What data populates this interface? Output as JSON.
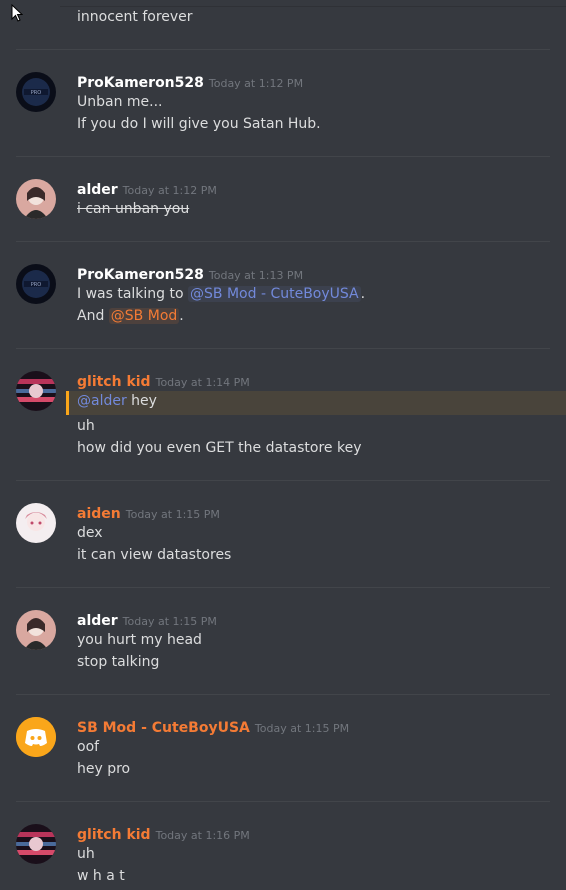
{
  "top_text": "innocent forever",
  "messages": [
    {
      "author": "ProKameron528",
      "timestamp": "Today at 1:12 PM",
      "lines": [
        "Unban me...",
        "If you do I will give you Satan Hub."
      ]
    },
    {
      "author": "alder",
      "timestamp": "Today at 1:12 PM",
      "lines": [
        "i can unban you"
      ]
    },
    {
      "author": "ProKameron528",
      "timestamp": "Today at 1:13 PM",
      "line1_prefix": "I was talking to ",
      "line1_mention": "@SB Mod - CuteBoyUSA",
      "line1_suffix": ".",
      "line2_prefix": "And ",
      "line2_mention": "@SB Mod",
      "line2_suffix": "."
    },
    {
      "author": "glitch kid",
      "timestamp": "Today at 1:14 PM",
      "line1_mention": "@alder",
      "line1_text": " hey",
      "lines": [
        "uh",
        "how did you even GET the datastore key"
      ]
    },
    {
      "author": "aiden",
      "timestamp": "Today at 1:15 PM",
      "lines": [
        "dex",
        "it can view datastores"
      ]
    },
    {
      "author": "alder",
      "timestamp": "Today at 1:15 PM",
      "lines": [
        "you hurt my head",
        "stop talking"
      ]
    },
    {
      "author": "SB Mod - CuteBoyUSA",
      "timestamp": "Today at 1:15 PM",
      "lines": [
        "oof",
        "hey pro"
      ]
    },
    {
      "author": "glitch kid",
      "timestamp": "Today at 1:16 PM",
      "lines": [
        "uh",
        "w h a t"
      ]
    }
  ],
  "colors": {
    "background": "#36393f",
    "mention": "#7289da",
    "orange_role": "#f47b35",
    "discord_avatar": "#faa61a"
  }
}
